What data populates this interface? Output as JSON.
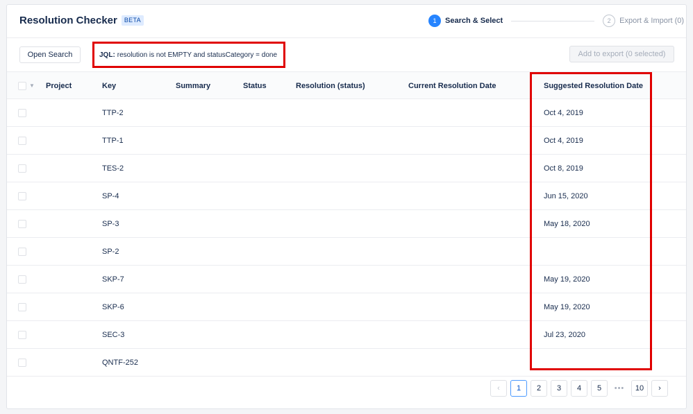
{
  "header": {
    "title": "Resolution Checker",
    "badge": "BETA",
    "steps": [
      {
        "num": "1",
        "label": "Search & Select",
        "state": "active"
      },
      {
        "num": "2",
        "label": "Export & Import (0)",
        "state": "inactive"
      }
    ]
  },
  "toolbar": {
    "open_search": "Open Search",
    "jql_prefix": "JQL:",
    "jql_query": "resolution is not EMPTY and statusCategory = done",
    "add_export": "Add to export (0 selected)"
  },
  "table": {
    "columns": [
      "Project",
      "Key",
      "Summary",
      "Status",
      "Resolution (status)",
      "Current Resolution Date",
      "Suggested Resolution Date"
    ],
    "rows": [
      {
        "key": "TTP-2",
        "suggested": "Oct 4, 2019"
      },
      {
        "key": "TTP-1",
        "suggested": "Oct 4, 2019"
      },
      {
        "key": "TES-2",
        "suggested": "Oct 8, 2019"
      },
      {
        "key": "SP-4",
        "suggested": "Jun 15, 2020"
      },
      {
        "key": "SP-3",
        "suggested": "May 18, 2020"
      },
      {
        "key": "SP-2",
        "suggested": ""
      },
      {
        "key": "SKP-7",
        "suggested": "May 19, 2020"
      },
      {
        "key": "SKP-6",
        "suggested": "May 19, 2020"
      },
      {
        "key": "SEC-3",
        "suggested": "Jul 23, 2020"
      },
      {
        "key": "QNTF-252",
        "suggested": ""
      }
    ]
  },
  "pagination": {
    "prev": "‹",
    "pages": [
      "1",
      "2",
      "3",
      "4",
      "5"
    ],
    "ellipsis": "•••",
    "last": "10",
    "next": "›",
    "current": "1"
  },
  "colors": {
    "accent": "#2684ff",
    "highlight": "#e00000"
  },
  "icons": {
    "checkbox": "checkbox-icon",
    "chevron": "chevron-down-icon"
  }
}
